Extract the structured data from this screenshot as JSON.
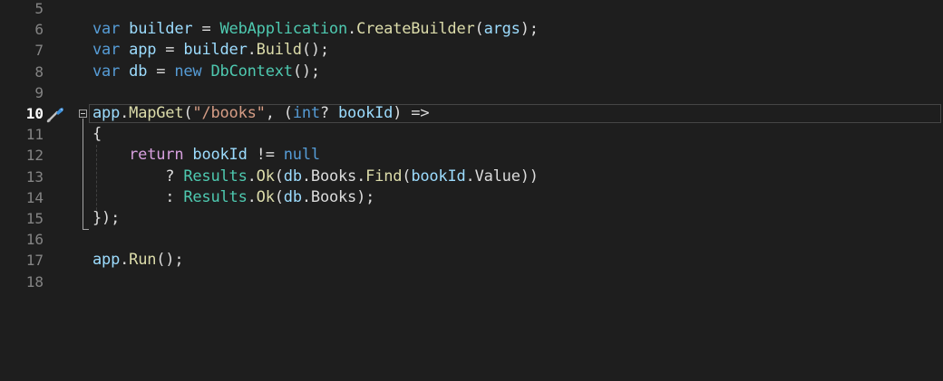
{
  "editor": {
    "current_line": "10",
    "lines": [
      {
        "num": "5",
        "tokens": []
      },
      {
        "num": "6",
        "tokens": [
          {
            "c": "kw",
            "t": "var"
          },
          {
            "c": "pun",
            "t": " "
          },
          {
            "c": "var",
            "t": "builder"
          },
          {
            "c": "pun",
            "t": " = "
          },
          {
            "c": "type",
            "t": "WebApplication"
          },
          {
            "c": "pun",
            "t": "."
          },
          {
            "c": "fn",
            "t": "CreateBuilder"
          },
          {
            "c": "pun",
            "t": "("
          },
          {
            "c": "var",
            "t": "args"
          },
          {
            "c": "pun",
            "t": ");"
          }
        ]
      },
      {
        "num": "7",
        "tokens": [
          {
            "c": "kw",
            "t": "var"
          },
          {
            "c": "pun",
            "t": " "
          },
          {
            "c": "var",
            "t": "app"
          },
          {
            "c": "pun",
            "t": " = "
          },
          {
            "c": "var",
            "t": "builder"
          },
          {
            "c": "pun",
            "t": "."
          },
          {
            "c": "fn",
            "t": "Build"
          },
          {
            "c": "pun",
            "t": "();"
          }
        ]
      },
      {
        "num": "8",
        "tokens": [
          {
            "c": "kw",
            "t": "var"
          },
          {
            "c": "pun",
            "t": " "
          },
          {
            "c": "var",
            "t": "db"
          },
          {
            "c": "pun",
            "t": " = "
          },
          {
            "c": "kw",
            "t": "new"
          },
          {
            "c": "pun",
            "t": " "
          },
          {
            "c": "type",
            "t": "DbContext"
          },
          {
            "c": "pun",
            "t": "();"
          }
        ]
      },
      {
        "num": "9",
        "tokens": []
      },
      {
        "num": "10",
        "tokens": [
          {
            "c": "var",
            "t": "app"
          },
          {
            "c": "pun",
            "t": "."
          },
          {
            "c": "fn",
            "t": "MapGet"
          },
          {
            "c": "pun",
            "t": "("
          },
          {
            "c": "str",
            "t": "\"/books\""
          },
          {
            "c": "pun",
            "t": ", ("
          },
          {
            "c": "kw",
            "t": "int"
          },
          {
            "c": "pun",
            "t": "? "
          },
          {
            "c": "var",
            "t": "bookId"
          },
          {
            "c": "pun",
            "t": ") =>"
          }
        ]
      },
      {
        "num": "11",
        "tokens": [
          {
            "c": "pun",
            "t": "{"
          }
        ]
      },
      {
        "num": "12",
        "tokens": [
          {
            "c": "pun",
            "t": "    "
          },
          {
            "c": "ctl",
            "t": "return"
          },
          {
            "c": "pun",
            "t": " "
          },
          {
            "c": "var",
            "t": "bookId"
          },
          {
            "c": "pun",
            "t": " != "
          },
          {
            "c": "kw",
            "t": "null"
          }
        ]
      },
      {
        "num": "13",
        "tokens": [
          {
            "c": "pun",
            "t": "        ? "
          },
          {
            "c": "type",
            "t": "Results"
          },
          {
            "c": "pun",
            "t": "."
          },
          {
            "c": "fn",
            "t": "Ok"
          },
          {
            "c": "pun",
            "t": "("
          },
          {
            "c": "var",
            "t": "db"
          },
          {
            "c": "pun",
            "t": "."
          },
          {
            "c": "pun",
            "t": "Books"
          },
          {
            "c": "pun",
            "t": "."
          },
          {
            "c": "fn",
            "t": "Find"
          },
          {
            "c": "pun",
            "t": "("
          },
          {
            "c": "var",
            "t": "bookId"
          },
          {
            "c": "pun",
            "t": ".Value))"
          }
        ]
      },
      {
        "num": "14",
        "tokens": [
          {
            "c": "pun",
            "t": "        : "
          },
          {
            "c": "type",
            "t": "Results"
          },
          {
            "c": "pun",
            "t": "."
          },
          {
            "c": "fn",
            "t": "Ok"
          },
          {
            "c": "pun",
            "t": "("
          },
          {
            "c": "var",
            "t": "db"
          },
          {
            "c": "pun",
            "t": "."
          },
          {
            "c": "pun",
            "t": "Books"
          },
          {
            "c": "pun",
            "t": ");"
          }
        ]
      },
      {
        "num": "15",
        "tokens": [
          {
            "c": "pun",
            "t": "});"
          }
        ]
      },
      {
        "num": "16",
        "tokens": []
      },
      {
        "num": "17",
        "tokens": [
          {
            "c": "var",
            "t": "app"
          },
          {
            "c": "pun",
            "t": "."
          },
          {
            "c": "fn",
            "t": "Run"
          },
          {
            "c": "pun",
            "t": "();"
          }
        ]
      },
      {
        "num": "18",
        "tokens": []
      }
    ]
  },
  "colors": {
    "background": "#1e1e1e",
    "keyword": "#569cd6",
    "control_keyword": "#d8a0df",
    "type": "#4ec9b0",
    "method": "#dcdcaa",
    "variable": "#9cdcfe",
    "string": "#d69d85",
    "punctuation": "#dcdcdc",
    "line_number": "#848484"
  },
  "icons": {
    "quick_actions": "screwdriver-icon",
    "collapse": "collapse-toggle"
  }
}
